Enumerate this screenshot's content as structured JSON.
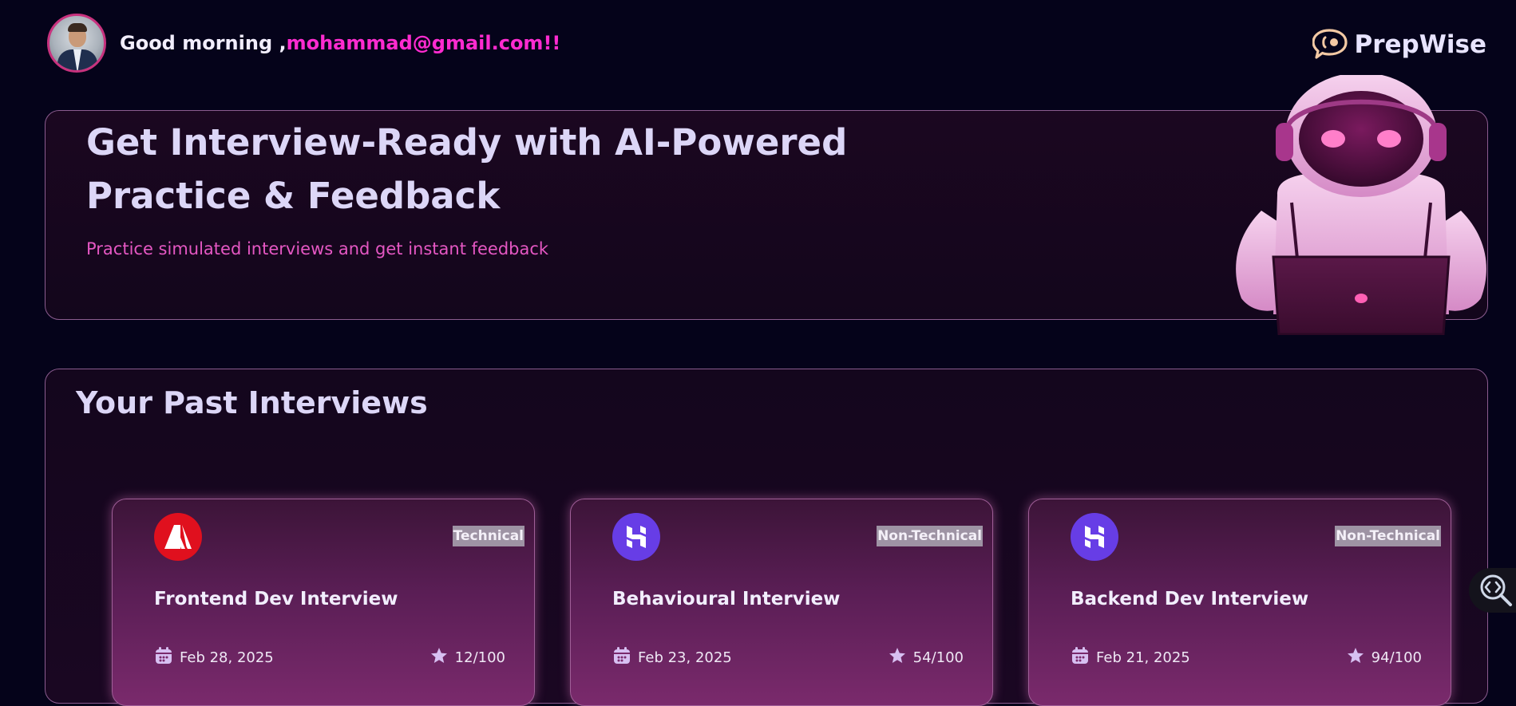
{
  "header": {
    "greeting_prefix": "Good morning ,",
    "greeting_email": "mohammad@gmail.com!!",
    "brand_name": "PrepWise"
  },
  "hero": {
    "title": "Get Interview-Ready with AI-Powered Practice & Feedback",
    "subtitle": "Practice simulated interviews and get instant feedback"
  },
  "past_interviews": {
    "title": "Your Past Interviews",
    "cards": [
      {
        "logo": "adobe-logo-icon",
        "tag": "Technical",
        "title": "Frontend Dev Interview",
        "date": "Feb 28, 2025",
        "score": "12/100"
      },
      {
        "logo": "hostinger-logo-icon",
        "tag": "Non-Technical",
        "title": "Behavioural Interview",
        "date": "Feb 23, 2025",
        "score": "54/100"
      },
      {
        "logo": "hostinger-logo-icon",
        "tag": "Non-Technical",
        "title": "Backend Dev Interview",
        "date": "Feb 21, 2025",
        "score": "94/100"
      }
    ]
  },
  "colors": {
    "background": "#05031a",
    "accent_pink": "#ff2bd0",
    "subtitle_pink": "#e557c3",
    "card_border": "#a05f98",
    "adobe_red": "#e0101e",
    "hostinger_purple": "#673de6"
  }
}
